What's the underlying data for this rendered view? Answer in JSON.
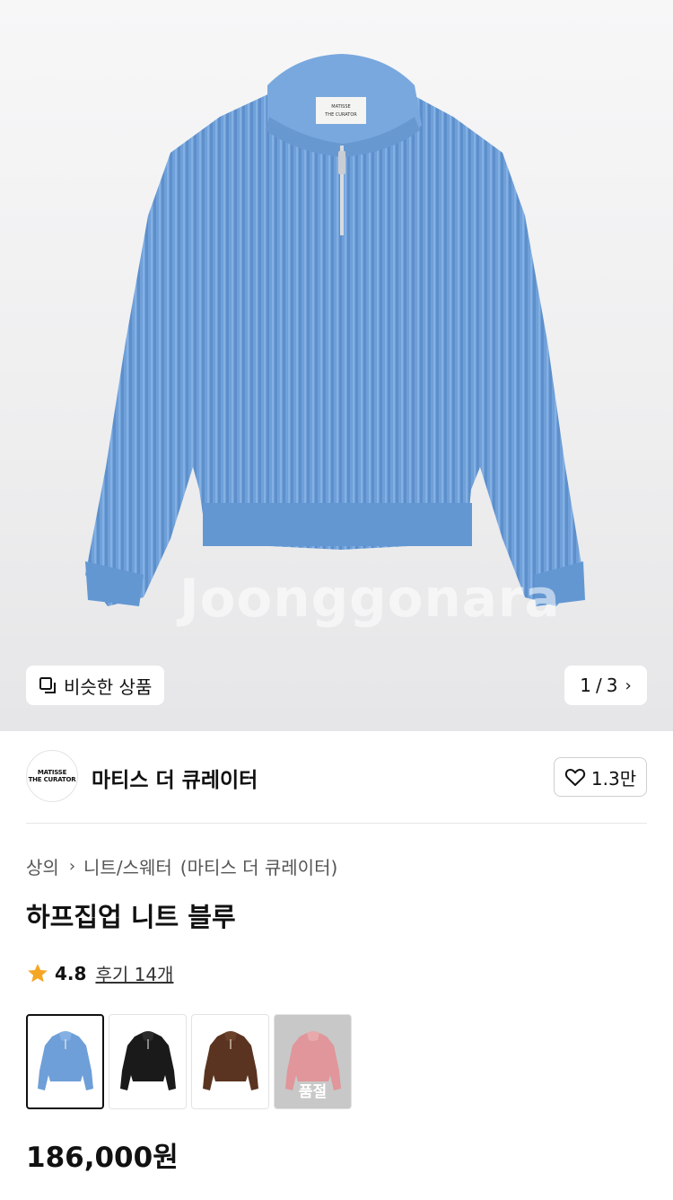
{
  "hero": {
    "watermark": "Joonggonara",
    "similar_label": "비슷한 상품",
    "pager_current": "1",
    "pager_sep": "/",
    "pager_total": "3",
    "sweater_color": "#6e9fd8"
  },
  "seller": {
    "logo_line1": "MATISSE",
    "logo_line2": "THE CURATOR",
    "name": "마티스 더 큐레이터",
    "likes": "1.3만"
  },
  "product": {
    "category": [
      "상의",
      "니트/스웨터"
    ],
    "brand_paren": "(마티스 더 큐레이터)",
    "title": "하프집업 니트 블루",
    "rating": "4.8",
    "reviews": "후기 14개",
    "price": "186,000원",
    "soldout_label": "품절",
    "colors": [
      {
        "name": "blue",
        "hex": "#6e9fd8",
        "selected": true,
        "soldout": false
      },
      {
        "name": "black",
        "hex": "#1a1a1a",
        "selected": false,
        "soldout": false
      },
      {
        "name": "brown",
        "hex": "#5a3420",
        "selected": false,
        "soldout": false
      },
      {
        "name": "pink",
        "hex": "#e0969a",
        "selected": false,
        "soldout": true
      }
    ]
  },
  "colors": {
    "star": "#f5a623",
    "text": "#111111",
    "border": "#cfcfcf"
  }
}
